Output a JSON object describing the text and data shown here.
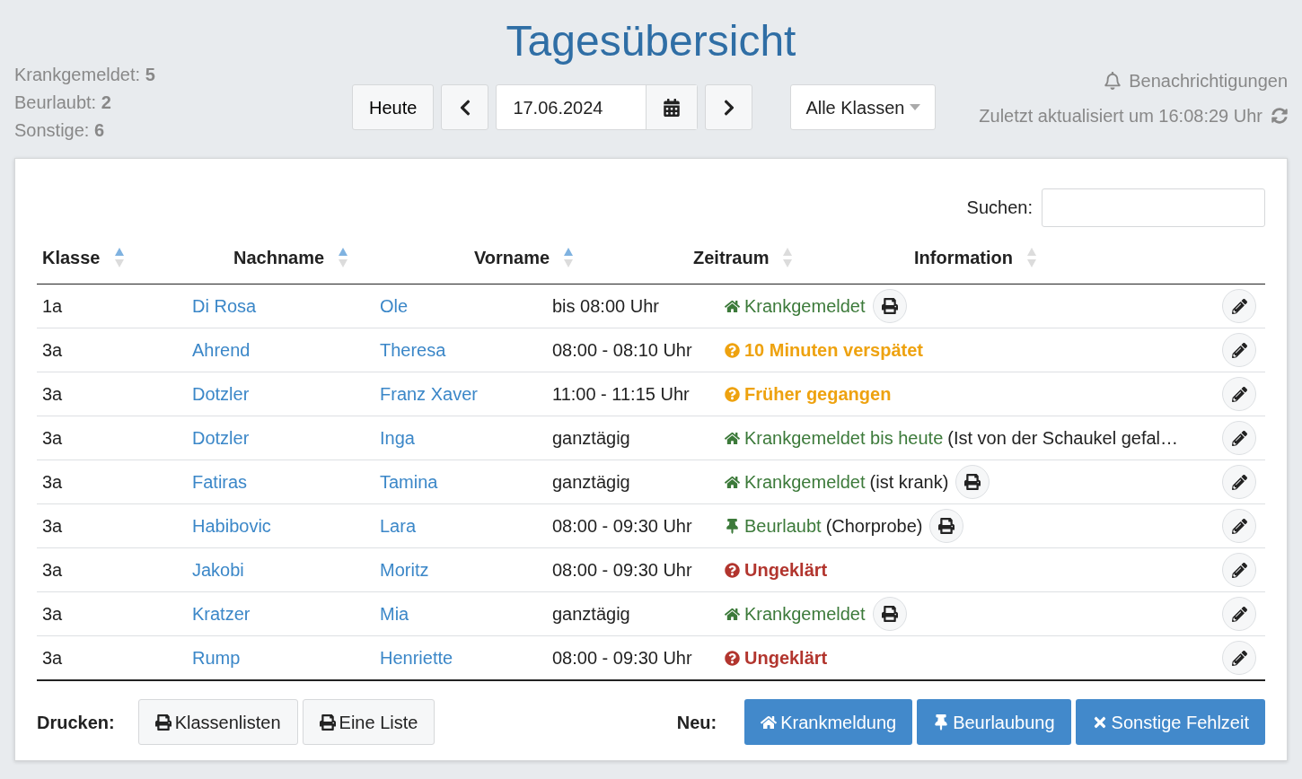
{
  "title": "Tagesübersicht",
  "summary": [
    {
      "label": "Krankgemeldet:",
      "count": "5"
    },
    {
      "label": "Beurlaubt:",
      "count": "2"
    },
    {
      "label": "Sonstige:",
      "count": "6"
    }
  ],
  "toolbar": {
    "today": "Heute",
    "date": "17.06.2024",
    "class_filter": "Alle Klassen"
  },
  "notifications": "Benachrichtigungen",
  "last_updated": "Zuletzt aktualisiert um 16:08:29 Uhr",
  "search": {
    "label": "Suchen:"
  },
  "table": {
    "columns": [
      {
        "label": "Klasse",
        "sorted": true
      },
      {
        "label": "Nachname",
        "sorted": true
      },
      {
        "label": "Vorname",
        "sorted": true
      },
      {
        "label": "Zeitraum",
        "sorted": false
      },
      {
        "label": "Information",
        "sorted": false
      }
    ],
    "rows": [
      {
        "klasse": "1a",
        "nachname": "Di Rosa",
        "vorname": "Ole",
        "zeitraum": "bis 08:00 Uhr",
        "status": {
          "kind": "sick",
          "label": "Krankgemeldet"
        },
        "print": true
      },
      {
        "klasse": "3a",
        "nachname": "Ahrend",
        "vorname": "Theresa",
        "zeitraum": "08:00 - 08:10 Uhr",
        "status": {
          "kind": "late",
          "label": "10 Minuten verspätet"
        },
        "print": false
      },
      {
        "klasse": "3a",
        "nachname": "Dotzler",
        "vorname": "Franz Xaver",
        "zeitraum": "11:00 - 11:15 Uhr",
        "status": {
          "kind": "late",
          "label": "Früher gegangen"
        },
        "print": false
      },
      {
        "klasse": "3a",
        "nachname": "Dotzler",
        "vorname": "Inga",
        "zeitraum": "ganztägig",
        "status": {
          "kind": "sick",
          "label": "Krankgemeldet bis heute"
        },
        "note": "(Ist von der Schaukel gefal…",
        "print": false
      },
      {
        "klasse": "3a",
        "nachname": "Fatiras",
        "vorname": "Tamina",
        "zeitraum": "ganztägig",
        "status": {
          "kind": "sick",
          "label": "Krankgemeldet"
        },
        "note": "(ist krank)",
        "print": true
      },
      {
        "klasse": "3a",
        "nachname": "Habibovic",
        "vorname": "Lara",
        "zeitraum": "08:00 - 09:30 Uhr",
        "status": {
          "kind": "leave",
          "label": "Beurlaubt"
        },
        "note": "(Chorprobe)",
        "print": true
      },
      {
        "klasse": "3a",
        "nachname": "Jakobi",
        "vorname": "Moritz",
        "zeitraum": "08:00 - 09:30 Uhr",
        "status": {
          "kind": "unclear",
          "label": "Ungeklärt"
        },
        "print": false
      },
      {
        "klasse": "3a",
        "nachname": "Kratzer",
        "vorname": "Mia",
        "zeitraum": "ganztägig",
        "status": {
          "kind": "sick",
          "label": "Krankgemeldet"
        },
        "print": true
      },
      {
        "klasse": "3a",
        "nachname": "Rump",
        "vorname": "Henriette",
        "zeitraum": "08:00 - 09:30 Uhr",
        "status": {
          "kind": "unclear",
          "label": "Ungeklärt"
        },
        "print": false
      }
    ]
  },
  "footer": {
    "print_label": "Drucken:",
    "print_buttons": [
      "Klassenlisten",
      "Eine Liste"
    ],
    "new_label": "Neu:",
    "new_buttons": [
      {
        "kind": "sick",
        "label": "Krankmeldung"
      },
      {
        "kind": "leave",
        "label": "Beurlaubung"
      },
      {
        "kind": "other",
        "label": "Sonstige Fehlzeit"
      }
    ]
  }
}
